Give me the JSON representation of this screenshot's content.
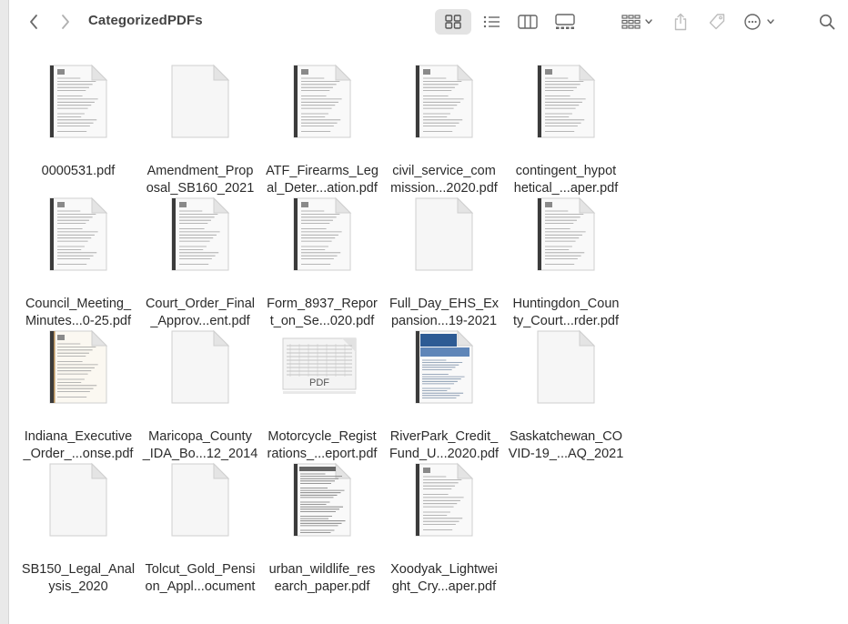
{
  "window": {
    "title": "CategorizedPDFs"
  },
  "toolbar": {
    "back_icon": "chevron-left-icon",
    "forward_icon": "chevron-right-icon",
    "views": [
      "icon-view",
      "list-view",
      "column-view",
      "gallery-view"
    ],
    "selected_view": "icon-view",
    "group_icon": "group-icon",
    "share_icon": "share-icon",
    "tag_icon": "tag-icon",
    "action_icon": "more-icon",
    "search_icon": "search-icon"
  },
  "files": [
    {
      "name": "0000531.pdf",
      "thumb": "doc"
    },
    {
      "name": "Amendment_Prop\nosal_SB160_2021",
      "thumb": "blank"
    },
    {
      "name": "ATF_Firearms_Leg\nal_Deter...ation.pdf",
      "thumb": "doc"
    },
    {
      "name": "civil_service_com\nmission...2020.pdf",
      "thumb": "doc"
    },
    {
      "name": "contingent_hypot\nhetical_...aper.pdf",
      "thumb": "doc"
    },
    {
      "name": "Council_Meeting_\nMinutes...0-25.pdf",
      "thumb": "doc"
    },
    {
      "name": "Court_Order_Final\n_Approv...ent.pdf",
      "thumb": "doc"
    },
    {
      "name": "Form_8937_Repor\nt_on_Se...020.pdf",
      "thumb": "doc"
    },
    {
      "name": "Full_Day_EHS_Ex\npansion...19-2021",
      "thumb": "blank"
    },
    {
      "name": "Huntingdon_Coun\nty_Court...rder.pdf",
      "thumb": "doc"
    },
    {
      "name": "Indiana_Executive\n_Order_...onse.pdf",
      "thumb": "doc-tan"
    },
    {
      "name": "Maricopa_County\n_IDA_Bo...12_2014",
      "thumb": "blank"
    },
    {
      "name": "Motorcycle_Regist\nrations_...eport.pdf",
      "thumb": "pdf-landscape",
      "label": "PDF"
    },
    {
      "name": "RiverPark_Credit_\nFund_U...2020.pdf",
      "thumb": "doc-blue"
    },
    {
      "name": "Saskatchewan_CO\nVID-19_...AQ_2021",
      "thumb": "blank"
    },
    {
      "name": "SB150_Legal_Anal\nysis_2020",
      "thumb": "blank"
    },
    {
      "name": "Tolcut_Gold_Pensi\non_Appl...ocument",
      "thumb": "blank"
    },
    {
      "name": "urban_wildlife_res\nearch_paper.pdf",
      "thumb": "doc-dense"
    },
    {
      "name": "Xoodyak_Lightwei\nght_Cry...aper.pdf",
      "thumb": "doc"
    }
  ]
}
